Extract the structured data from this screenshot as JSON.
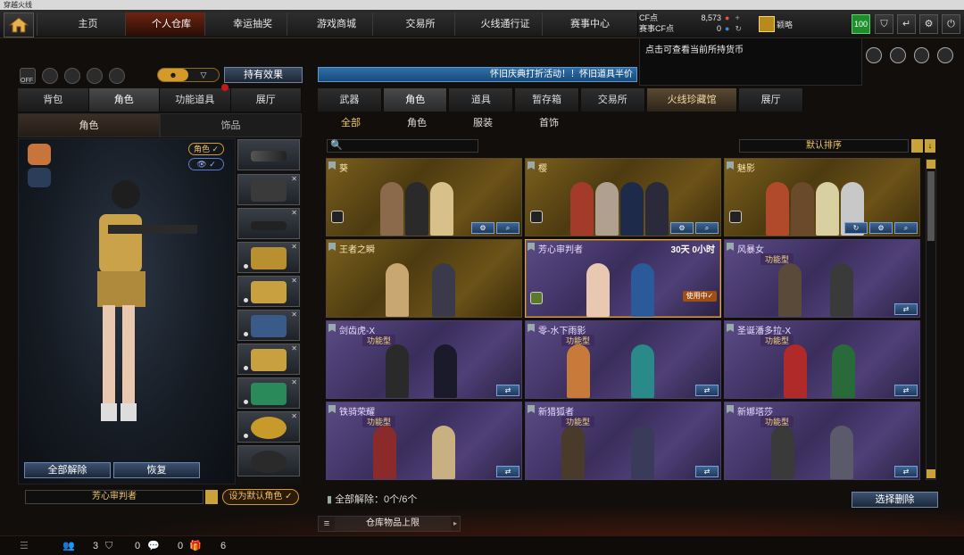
{
  "window": {
    "title": "穿越火线"
  },
  "nav": {
    "tabs": [
      "主页",
      "个人仓库",
      "幸运抽奖",
      "游戏商城",
      "交易所",
      "火线通行证",
      "赛事中心"
    ],
    "active_index": 1
  },
  "currency": {
    "cf_label": "CF点",
    "cf_value": "8,573",
    "event_label": "赛事CF点",
    "event_value": "0",
    "tooltip": "点击可查看当前所持货币"
  },
  "rank": {
    "name": "颖略"
  },
  "level": "100",
  "left": {
    "toggle_off": "OFF",
    "effects_button": "持有效果",
    "tabs": [
      "背包",
      "角色",
      "功能道具",
      "展厅"
    ],
    "active_tab": 1,
    "subtabs": [
      "角色",
      "饰品"
    ],
    "role_tag": "角色",
    "unequip_button": "全部解除",
    "restore_button": "恢复",
    "character_name": "芳心审判者",
    "set_default_button": "设为默认角色"
  },
  "right": {
    "banner": "怀旧庆典打折活动！！怀旧道具半价",
    "tabs": [
      "武器",
      "角色",
      "道具",
      "暂存箱",
      "交易所",
      "火线珍藏馆",
      "展厅"
    ],
    "active_tab": 1,
    "subtabs": [
      "全部",
      "角色",
      "服装",
      "首饰"
    ],
    "active_subtab": 0,
    "sort_label": "默认排序",
    "cards": [
      {
        "name": "葵",
        "style": "gold"
      },
      {
        "name": "樱",
        "style": "gold"
      },
      {
        "name": "魅影",
        "style": "gold"
      },
      {
        "name": "王者之瞬",
        "style": "gold"
      },
      {
        "name": "芳心审判者",
        "style": "purple",
        "timer": "30天 0小时",
        "in_use": "使用中"
      },
      {
        "name": "风暴女",
        "style": "purple",
        "func": "功能型"
      },
      {
        "name": "剑齿虎-X",
        "style": "purple",
        "func": "功能型"
      },
      {
        "name": "零-水下雨影",
        "style": "purple",
        "func": "功能型"
      },
      {
        "name": "圣诞潘多拉-X",
        "style": "purple",
        "func": "功能型"
      },
      {
        "name": "铁骑荣耀",
        "style": "purple",
        "func": "功能型"
      },
      {
        "name": "新猎狐者",
        "style": "purple",
        "func": "功能型"
      },
      {
        "name": "新娜塔莎",
        "style": "purple",
        "func": "功能型"
      }
    ],
    "unequip_status": "全部解除：0个/6个",
    "select_delete_button": "选择删除",
    "storage_label": "仓库物品上限"
  },
  "status": {
    "count_a": "3",
    "count_b": "0",
    "count_c": "0",
    "count_d": "6"
  },
  "colors": {
    "accent": "#d49a2a",
    "banner": "#2f6fa7",
    "gold_card": "#7a5f1d",
    "purple_card": "#5b4b86"
  }
}
